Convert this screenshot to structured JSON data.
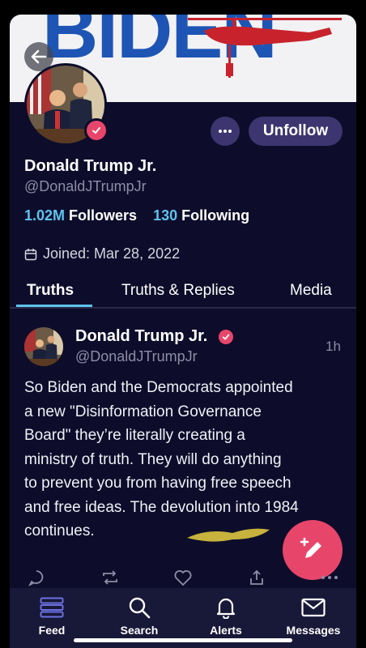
{
  "banner": {
    "text": "BIDEN"
  },
  "profile": {
    "name": "Donald Trump Jr.",
    "handle": "@DonaldJTrumpJr",
    "followers_count": "1.02M",
    "followers_label": "Followers",
    "following_count": "130",
    "following_label": "Following",
    "joined": "Joined: Mar 28, 2022"
  },
  "actions": {
    "unfollow_label": "Unfollow"
  },
  "tabs": [
    {
      "label": "Truths",
      "active": true
    },
    {
      "label": "Truths & Replies",
      "active": false
    },
    {
      "label": "Media",
      "active": false
    }
  ],
  "post": {
    "author": "Donald Trump Jr.",
    "handle": "@DonaldJTrumpJr",
    "time": "1h",
    "lines": [
      "So Biden and the Democrats appointed",
      "a new \"Disinformation Governance",
      "Board\" they’re literally creating a",
      "ministry of truth. They will do anything",
      "to prevent you from having free speech",
      "and free ideas. The devolution into 1984",
      "continues."
    ]
  },
  "nav": [
    {
      "label": "Feed",
      "icon": "feed-icon",
      "active": true
    },
    {
      "label": "Search",
      "icon": "search-icon"
    },
    {
      "label": "Alerts",
      "icon": "bell-icon"
    },
    {
      "label": "Messages",
      "icon": "mail-icon"
    }
  ],
  "colors": {
    "background": "#0d0d2b",
    "accent_pink": "#e8456b",
    "accent_blue": "#5ec3ee",
    "button_purple": "#3c3570",
    "nav_active": "#6b6fe0"
  }
}
